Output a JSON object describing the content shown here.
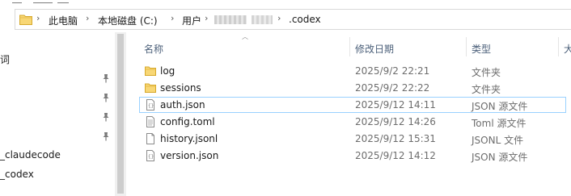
{
  "breadcrumb": {
    "items": [
      "此电脑",
      "本地磁盘 (C:)",
      "用户",
      ".codex"
    ],
    "separator": "›"
  },
  "nav": {
    "items": [
      {
        "label": "词"
      },
      {
        "label": "_claudecode"
      },
      {
        "label": "_codex"
      }
    ]
  },
  "columns": {
    "name": "名称",
    "date": "修改日期",
    "type": "类型",
    "size": "大"
  },
  "files": [
    {
      "name": "log",
      "date": "2025/9/2 22:21",
      "type": "文件夹",
      "icon": "folder-icon"
    },
    {
      "name": "sessions",
      "date": "2025/9/2 22:22",
      "type": "文件夹",
      "icon": "folder-icon"
    },
    {
      "name": "auth.json",
      "date": "2025/9/12 14:11",
      "type": "JSON 源文件",
      "icon": "json-file-icon",
      "selected": true
    },
    {
      "name": "config.toml",
      "date": "2025/9/12 14:26",
      "type": "Toml 源文件",
      "icon": "text-file-icon"
    },
    {
      "name": "history.jsonl",
      "date": "2025/9/12 15:31",
      "type": "JSONL 文件",
      "icon": "blank-file-icon"
    },
    {
      "name": "version.json",
      "date": "2025/9/12 14:12",
      "type": "JSON 源文件",
      "icon": "json-file-icon"
    }
  ],
  "colors": {
    "folder": "#e8b53c",
    "selection_border": "#99d1ff",
    "header_text": "#4c607a"
  }
}
